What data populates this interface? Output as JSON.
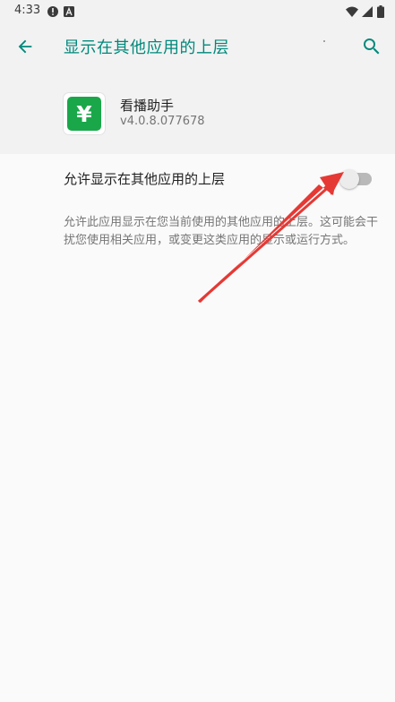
{
  "status_bar": {
    "time": "4:33",
    "left_icons": [
      "alert-circle-icon",
      "app-a-icon"
    ],
    "right_icons": [
      "wifi-icon",
      "signal-icon",
      "battery-icon"
    ]
  },
  "app_bar": {
    "title": "显示在其他应用的上层",
    "back_icon": "arrow-left-icon",
    "search_icon": "search-icon",
    "accent_color": "#00897b"
  },
  "app_info": {
    "name": "看播助手",
    "version": "v4.0.8.077678",
    "icon_glyph": "¥",
    "icon_color": "#1aa74a"
  },
  "setting": {
    "label": "允许显示在其他应用的上层",
    "enabled": false
  },
  "description": "允许此应用显示在您当前使用的其他应用的上层。这可能会干扰您使用相关应用，或变更这类应用的显示或运行方式。",
  "annotation": {
    "type": "red-arrow",
    "color": "#e53935",
    "points_to": "setting-toggle"
  }
}
